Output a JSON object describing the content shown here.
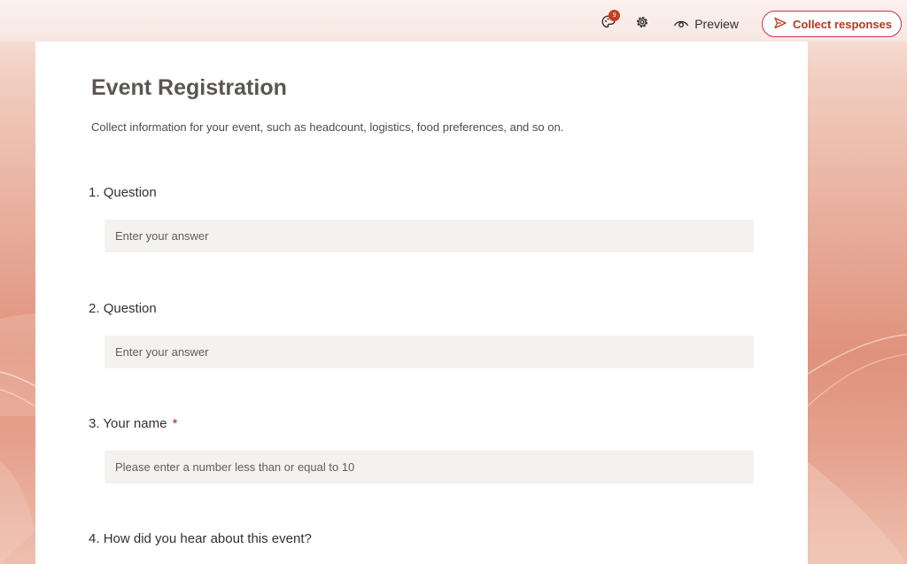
{
  "topbar": {
    "theme_badge": "9",
    "preview_label": "Preview",
    "collect_label": "Collect responses"
  },
  "form": {
    "title": "Event Registration",
    "description": "Collect information for your event, such as headcount, logistics, food preferences, and so on.",
    "questions": [
      {
        "number": "1.",
        "label": "Question",
        "required": false,
        "placeholder": "Enter your answer"
      },
      {
        "number": "2.",
        "label": "Question",
        "required": false,
        "placeholder": "Enter your answer"
      },
      {
        "number": "3.",
        "label": "Your name",
        "required": true,
        "required_mark": "*",
        "placeholder": "Please enter a number less than or equal to 10"
      },
      {
        "number": "4.",
        "label": "How did you hear about this event?",
        "required": false
      }
    ]
  },
  "colors": {
    "accent": "#b9371f",
    "badge": "#c43e1c",
    "required": "#a4262c",
    "answer_bg": "#f3f2f1"
  },
  "icons": {
    "theme": "palette-icon",
    "settings": "gear-icon",
    "preview": "eye-icon",
    "collect": "send-icon"
  }
}
